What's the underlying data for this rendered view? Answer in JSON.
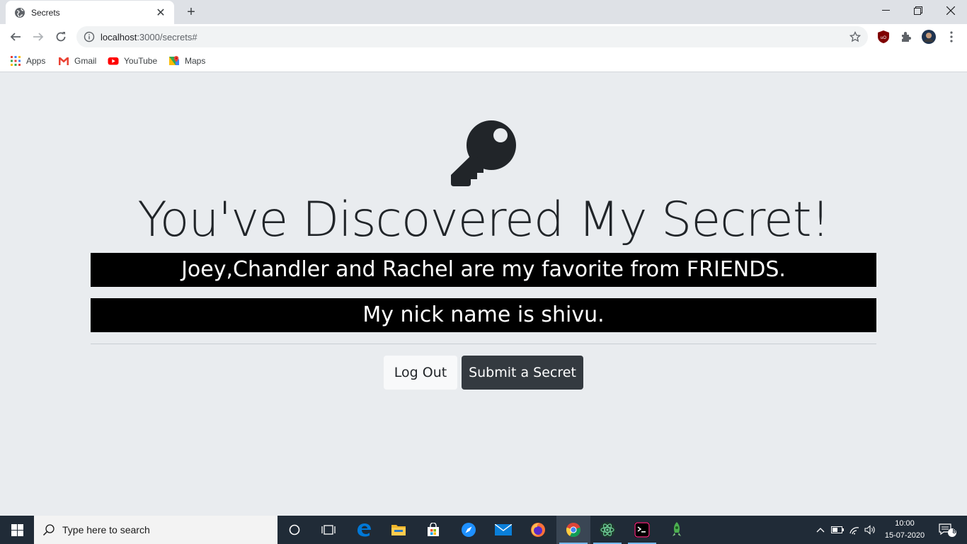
{
  "browser": {
    "tab_title": "Secrets",
    "url_host": "localhost",
    "url_path": ":3000/secrets#",
    "bookmarks": [
      {
        "label": "Apps",
        "icon": "apps-grid-icon"
      },
      {
        "label": "Gmail",
        "icon": "gmail-icon"
      },
      {
        "label": "YouTube",
        "icon": "youtube-icon"
      },
      {
        "label": "Maps",
        "icon": "maps-icon"
      }
    ]
  },
  "page": {
    "title": "You've Discovered My Secret!",
    "secrets": [
      "Joey,Chandler and Rachel are my favorite from FRIENDS.",
      "My nick name is shivu."
    ],
    "logout_label": "Log Out",
    "submit_label": "Submit a Secret"
  },
  "taskbar": {
    "search_placeholder": "Type here to search",
    "time": "10:00",
    "date": "15-07-2020",
    "notification_count": "8"
  },
  "colors": {
    "page_bg": "#e9ecef",
    "secret_bg": "#000000",
    "dark_button": "#343a40",
    "light_button": "#f8f9fa"
  }
}
